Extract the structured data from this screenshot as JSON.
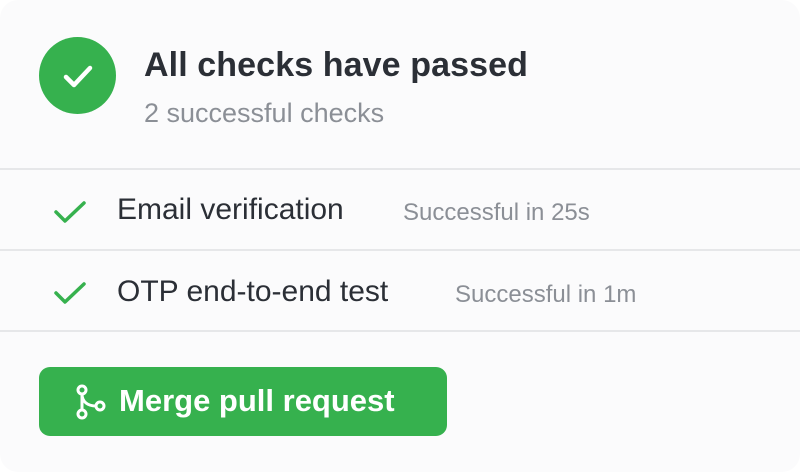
{
  "summary": {
    "title": "All checks have passed",
    "subtitle": "2 successful checks",
    "icon": "check-circle-icon"
  },
  "checks": [
    {
      "name": "Email verification",
      "status": "Successful in 25s",
      "icon": "check-icon"
    },
    {
      "name": "OTP end-to-end test",
      "status": "Successful in 1m",
      "icon": "check-icon"
    }
  ],
  "merge_button": {
    "label": "Merge pull request",
    "icon": "git-merge-icon"
  },
  "colors": {
    "success": "#36b14e",
    "text_primary": "#2b2f36",
    "text_secondary": "#8b8f96",
    "divider": "#e6e7e9"
  }
}
